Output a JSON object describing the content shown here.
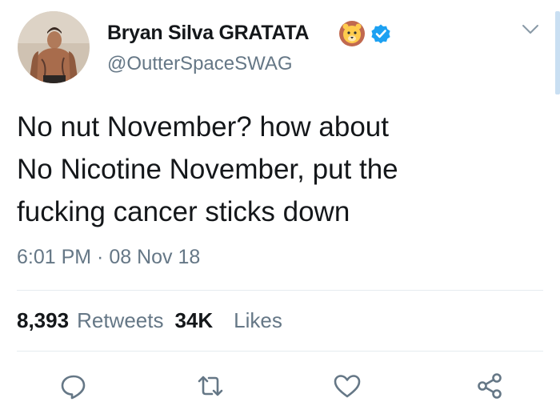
{
  "tweet": {
    "display_name": "Bryan Silva GRATATA",
    "handle": "@OutterSpaceSWAG",
    "text_lines": [
      "No nut November? how about",
      "No Nicotine November, put the",
      "fucking cancer sticks down"
    ],
    "timestamp": "6:01 PM · 08 Nov 18",
    "retweet_count": "8,393",
    "retweet_label": "Retweets",
    "like_count": "34K",
    "like_label": "Likes"
  },
  "icons": {
    "name_emoji": "lion-face-icon",
    "badge": "verified-badge-icon",
    "menu": "chevron-down-icon",
    "actions": [
      "reply-icon",
      "retweet-icon",
      "like-icon",
      "share-icon"
    ]
  },
  "colors": {
    "text": "#14171a",
    "secondary": "#657786",
    "verified": "#1da1f2",
    "divider": "#e6ecf0",
    "icon_gray": "#657786"
  }
}
